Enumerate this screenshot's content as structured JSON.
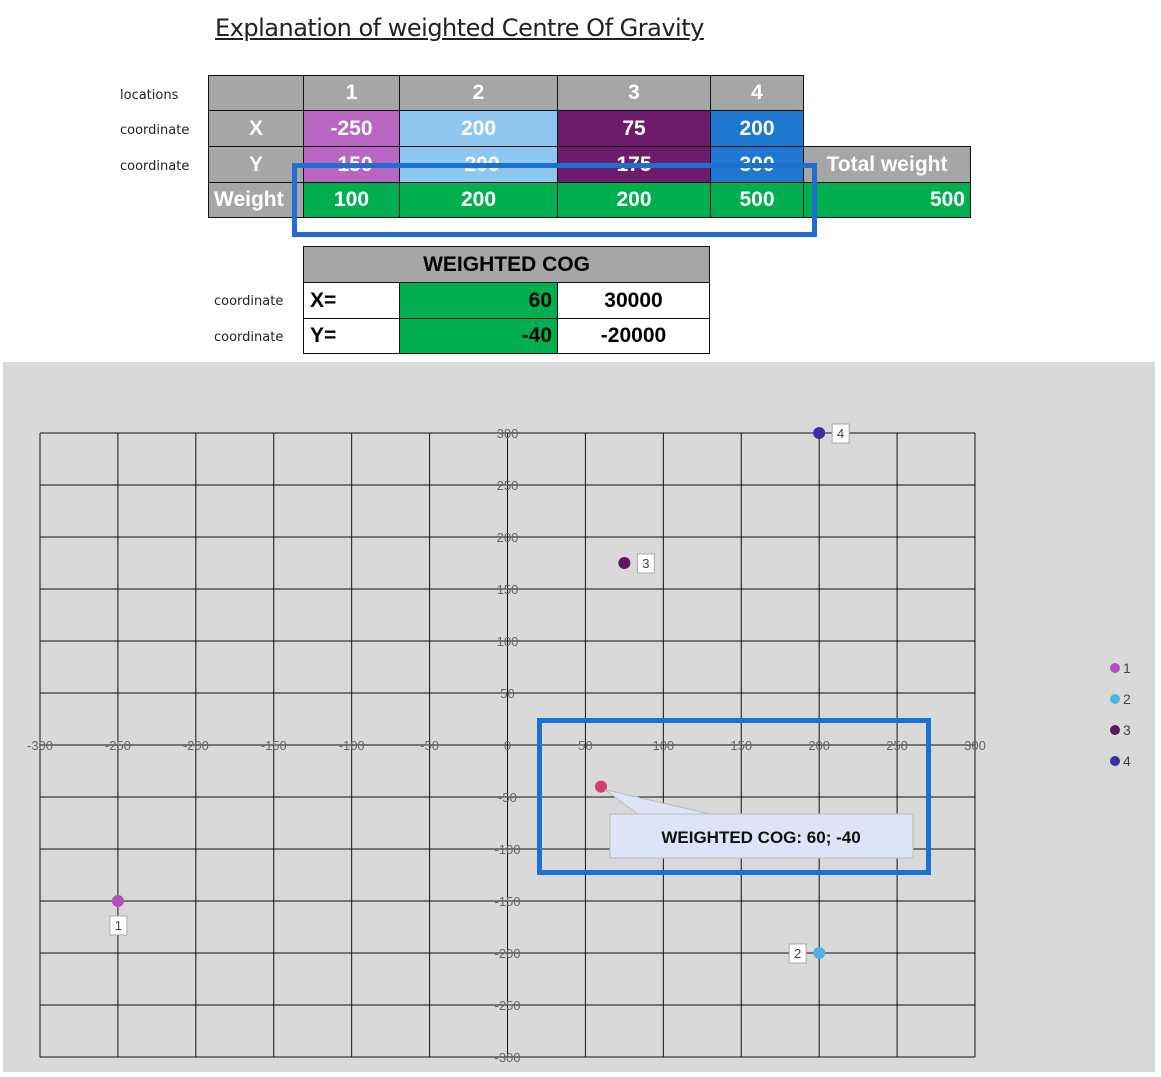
{
  "title": "Explanation of weighted Centre Of Gravity",
  "row_labels": [
    "locations",
    "coordinate",
    "coordinate"
  ],
  "table": {
    "locations": [
      "1",
      "2",
      "3",
      "4"
    ],
    "x_label": "X",
    "x": [
      "-250",
      "200",
      "75",
      "200"
    ],
    "y_label": "Y",
    "y": [
      "-150",
      "-200",
      "175",
      "300"
    ],
    "weight_label": "Weight",
    "weights": [
      "100",
      "200",
      "200",
      "500"
    ],
    "total_weight_label": "Total weight",
    "total_weight": "500",
    "colors": [
      "#b966c3",
      "#8ec8f0",
      "#6d1b6b",
      "#1f78d1"
    ]
  },
  "cog": {
    "header": "WEIGHTED COG",
    "row_labels": [
      "coordinate",
      "coordinate"
    ],
    "x_label": "X=",
    "x": "60",
    "x_sum": "30000",
    "y_label": "Y=",
    "y": "-40",
    "y_sum": "-20000"
  },
  "chart_data": {
    "type": "scatter",
    "xlim": [
      -300,
      300
    ],
    "ylim": [
      -300,
      300
    ],
    "tick_step": 50,
    "grid": true,
    "legend": "right",
    "points": [
      {
        "name": "1",
        "x": -250,
        "y": -150,
        "color": "#b24fc0"
      },
      {
        "name": "2",
        "x": 200,
        "y": -200,
        "color": "#4fb0e6"
      },
      {
        "name": "3",
        "x": 75,
        "y": 175,
        "color": "#5a1a5a"
      },
      {
        "name": "4",
        "x": 200,
        "y": 300,
        "color": "#3a2fa0"
      }
    ],
    "cog": {
      "x": 60,
      "y": -40,
      "color": "#d0406a",
      "label": "WEIGHTED COG:  60; -40"
    }
  }
}
